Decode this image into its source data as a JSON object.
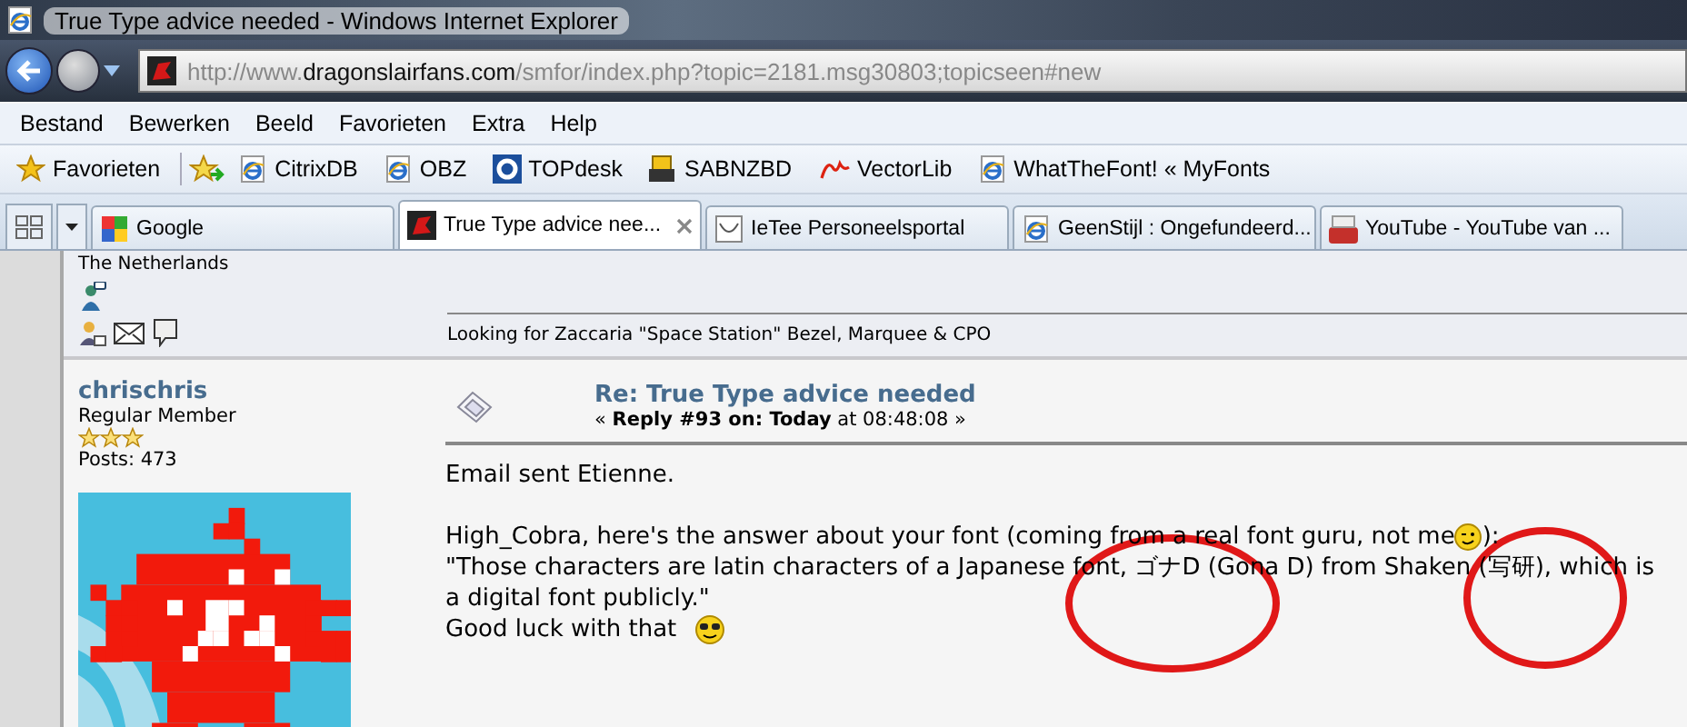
{
  "window": {
    "title": "True Type advice needed - Windows Internet Explorer"
  },
  "address_bar": {
    "url": "http://www.**dragonslairfans.com**/smfor/index.php?topic=2181.msg30803;topicseen#new"
  },
  "menu": [
    "Bestand",
    "Bewerken",
    "Beeld",
    "Favorieten",
    "Extra",
    "Help"
  ],
  "favorites_bar": {
    "favorites": "Favorieten",
    "links": [
      {
        "label": "CitrixDB",
        "kind": "ie"
      },
      {
        "label": "OBZ",
        "kind": "ie"
      },
      {
        "label": "TOPdesk",
        "kind": "ring"
      },
      {
        "label": "SABNZBD",
        "kind": "sab"
      },
      {
        "label": "VectorLib",
        "kind": "free"
      },
      {
        "label": "WhatTheFont! « MyFonts",
        "kind": "ie"
      }
    ]
  },
  "tabs": [
    {
      "label": "Google",
      "kind": "google",
      "selected": false
    },
    {
      "label": "True Type advice nee...",
      "kind": "dragon",
      "selected": true
    },
    {
      "label": "IeTee Personeelsportal",
      "kind": "blank",
      "selected": false
    },
    {
      "label": "GeenStijl : Ongefundeerd...",
      "kind": "ie",
      "selected": false
    },
    {
      "label": "YouTube - YouTube van ...",
      "kind": "youtube",
      "selected": false
    }
  ],
  "previous_post": {
    "location": "The Netherlands",
    "signature": "Looking for Zaccaria \"Space Station\" Bezel, Marquee & CPO"
  },
  "post": {
    "author": "chrischris",
    "rank": "Regular Member",
    "stars": 3,
    "posts": "Posts: 473",
    "subject": "Re: True Type advice needed",
    "reply_info": "« **Reply #93 on: Today** at 08:48:08 »",
    "paragraphs": [
      {
        "lines": [
          {
            "text": "Email sent Etienne."
          }
        ]
      },
      {
        "lines": [
          {
            "text": "High_Cobra, here's the answer about your font (coming from a real font guru, not me",
            "smiley": {
              "kind": "wink"
            },
            "after": "):"
          },
          {
            "text": "\"Those characters are latin characters of a Japanese font, ゴナD (Gona D) from Shaken (写研), which is"
          },
          {
            "text": "a digital font publicly.\""
          },
          {
            "text": "Good luck with that",
            "smiley": {
              "kind": "cool"
            }
          }
        ]
      }
    ]
  }
}
